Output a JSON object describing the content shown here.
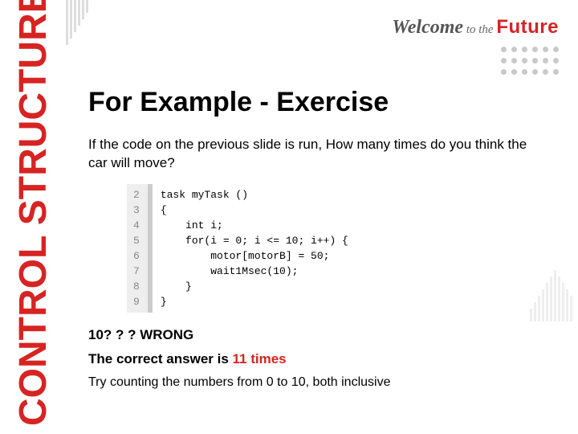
{
  "sidebar": {
    "label": "CONTROL STRUCTURES"
  },
  "header": {
    "welcome_main": "Welcome",
    "welcome_to": " to the ",
    "welcome_future": "Future"
  },
  "title": "For Example - Exercise",
  "question": "If the code on the previous slide is run, How many times do you think the car will move?",
  "code": {
    "gutter": [
      "2",
      "3",
      "4",
      "5",
      "6",
      "7",
      "8",
      "9"
    ],
    "lines": [
      "task myTask ()",
      "{",
      "    int i;",
      "    for(i = 0; i <= 10; i++) {",
      "        motor[motorB] = 50;",
      "        wait1Msec(10);",
      "    }",
      "}"
    ]
  },
  "wrong": "10? ? ? WRONG",
  "answer_prefix": "The correct answer is ",
  "answer_value": "11 times",
  "hint": "Try counting the numbers from 0 to 10, both inclusive"
}
